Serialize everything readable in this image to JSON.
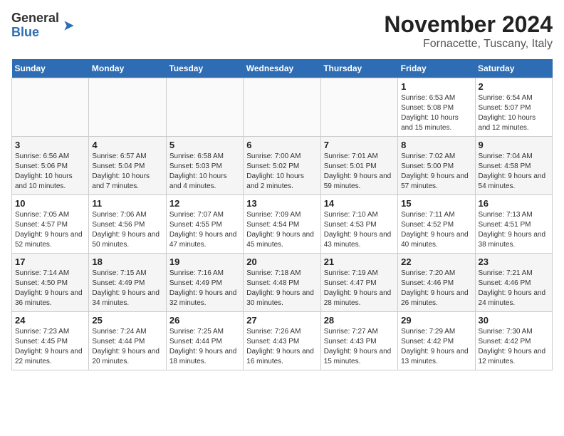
{
  "header": {
    "logo_general": "General",
    "logo_blue": "Blue",
    "month_title": "November 2024",
    "location": "Fornacette, Tuscany, Italy"
  },
  "weekdays": [
    "Sunday",
    "Monday",
    "Tuesday",
    "Wednesday",
    "Thursday",
    "Friday",
    "Saturday"
  ],
  "weeks": [
    [
      {
        "day": "",
        "info": ""
      },
      {
        "day": "",
        "info": ""
      },
      {
        "day": "",
        "info": ""
      },
      {
        "day": "",
        "info": ""
      },
      {
        "day": "",
        "info": ""
      },
      {
        "day": "1",
        "info": "Sunrise: 6:53 AM\nSunset: 5:08 PM\nDaylight: 10 hours and 15 minutes."
      },
      {
        "day": "2",
        "info": "Sunrise: 6:54 AM\nSunset: 5:07 PM\nDaylight: 10 hours and 12 minutes."
      }
    ],
    [
      {
        "day": "3",
        "info": "Sunrise: 6:56 AM\nSunset: 5:06 PM\nDaylight: 10 hours and 10 minutes."
      },
      {
        "day": "4",
        "info": "Sunrise: 6:57 AM\nSunset: 5:04 PM\nDaylight: 10 hours and 7 minutes."
      },
      {
        "day": "5",
        "info": "Sunrise: 6:58 AM\nSunset: 5:03 PM\nDaylight: 10 hours and 4 minutes."
      },
      {
        "day": "6",
        "info": "Sunrise: 7:00 AM\nSunset: 5:02 PM\nDaylight: 10 hours and 2 minutes."
      },
      {
        "day": "7",
        "info": "Sunrise: 7:01 AM\nSunset: 5:01 PM\nDaylight: 9 hours and 59 minutes."
      },
      {
        "day": "8",
        "info": "Sunrise: 7:02 AM\nSunset: 5:00 PM\nDaylight: 9 hours and 57 minutes."
      },
      {
        "day": "9",
        "info": "Sunrise: 7:04 AM\nSunset: 4:58 PM\nDaylight: 9 hours and 54 minutes."
      }
    ],
    [
      {
        "day": "10",
        "info": "Sunrise: 7:05 AM\nSunset: 4:57 PM\nDaylight: 9 hours and 52 minutes."
      },
      {
        "day": "11",
        "info": "Sunrise: 7:06 AM\nSunset: 4:56 PM\nDaylight: 9 hours and 50 minutes."
      },
      {
        "day": "12",
        "info": "Sunrise: 7:07 AM\nSunset: 4:55 PM\nDaylight: 9 hours and 47 minutes."
      },
      {
        "day": "13",
        "info": "Sunrise: 7:09 AM\nSunset: 4:54 PM\nDaylight: 9 hours and 45 minutes."
      },
      {
        "day": "14",
        "info": "Sunrise: 7:10 AM\nSunset: 4:53 PM\nDaylight: 9 hours and 43 minutes."
      },
      {
        "day": "15",
        "info": "Sunrise: 7:11 AM\nSunset: 4:52 PM\nDaylight: 9 hours and 40 minutes."
      },
      {
        "day": "16",
        "info": "Sunrise: 7:13 AM\nSunset: 4:51 PM\nDaylight: 9 hours and 38 minutes."
      }
    ],
    [
      {
        "day": "17",
        "info": "Sunrise: 7:14 AM\nSunset: 4:50 PM\nDaylight: 9 hours and 36 minutes."
      },
      {
        "day": "18",
        "info": "Sunrise: 7:15 AM\nSunset: 4:49 PM\nDaylight: 9 hours and 34 minutes."
      },
      {
        "day": "19",
        "info": "Sunrise: 7:16 AM\nSunset: 4:49 PM\nDaylight: 9 hours and 32 minutes."
      },
      {
        "day": "20",
        "info": "Sunrise: 7:18 AM\nSunset: 4:48 PM\nDaylight: 9 hours and 30 minutes."
      },
      {
        "day": "21",
        "info": "Sunrise: 7:19 AM\nSunset: 4:47 PM\nDaylight: 9 hours and 28 minutes."
      },
      {
        "day": "22",
        "info": "Sunrise: 7:20 AM\nSunset: 4:46 PM\nDaylight: 9 hours and 26 minutes."
      },
      {
        "day": "23",
        "info": "Sunrise: 7:21 AM\nSunset: 4:46 PM\nDaylight: 9 hours and 24 minutes."
      }
    ],
    [
      {
        "day": "24",
        "info": "Sunrise: 7:23 AM\nSunset: 4:45 PM\nDaylight: 9 hours and 22 minutes."
      },
      {
        "day": "25",
        "info": "Sunrise: 7:24 AM\nSunset: 4:44 PM\nDaylight: 9 hours and 20 minutes."
      },
      {
        "day": "26",
        "info": "Sunrise: 7:25 AM\nSunset: 4:44 PM\nDaylight: 9 hours and 18 minutes."
      },
      {
        "day": "27",
        "info": "Sunrise: 7:26 AM\nSunset: 4:43 PM\nDaylight: 9 hours and 16 minutes."
      },
      {
        "day": "28",
        "info": "Sunrise: 7:27 AM\nSunset: 4:43 PM\nDaylight: 9 hours and 15 minutes."
      },
      {
        "day": "29",
        "info": "Sunrise: 7:29 AM\nSunset: 4:42 PM\nDaylight: 9 hours and 13 minutes."
      },
      {
        "day": "30",
        "info": "Sunrise: 7:30 AM\nSunset: 4:42 PM\nDaylight: 9 hours and 12 minutes."
      }
    ]
  ]
}
